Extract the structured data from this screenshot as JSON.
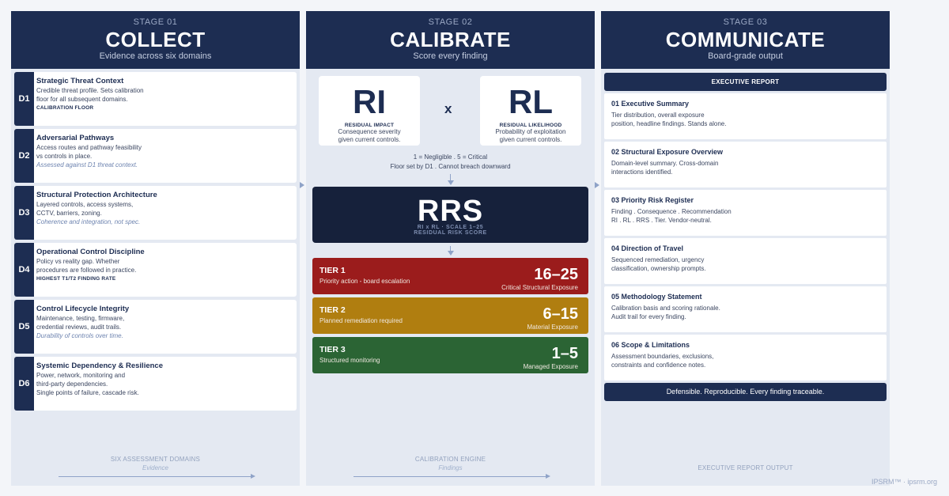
{
  "stages": [
    {
      "stage": "STAGE 01",
      "title": "COLLECT",
      "subtitle": "Evidence across six domains",
      "footer": "SIX ASSESSMENT DOMAINS",
      "footer_sub": "Evidence"
    },
    {
      "stage": "STAGE 02",
      "title": "CALIBRATE",
      "subtitle": "Score every finding",
      "footer": "CALIBRATION ENGINE",
      "footer_sub": "Findings"
    },
    {
      "stage": "STAGE 03",
      "title": "COMMUNICATE",
      "subtitle": "Board-grade output",
      "footer": "EXECUTIVE REPORT OUTPUT",
      "footer_sub": ""
    }
  ],
  "domains": [
    {
      "code": "D1",
      "title": "Strategic Threat Context",
      "desc": "Credible threat profile. Sets calibration\nfloor for all subsequent domains.",
      "note": "",
      "key": "CALIBRATION FLOOR"
    },
    {
      "code": "D2",
      "title": "Adversarial Pathways",
      "desc": "Access routes and pathway feasibility\nvs controls in place.",
      "note": "Assessed against D1 threat context.",
      "key": ""
    },
    {
      "code": "D3",
      "title": "Structural Protection Architecture",
      "desc": "Layered controls, access systems,\nCCTV, barriers, zoning.",
      "note": "Coherence and integration, not spec.",
      "key": ""
    },
    {
      "code": "D4",
      "title": "Operational Control Discipline",
      "desc": "Policy vs reality gap. Whether\nprocedures are followed in practice.",
      "note": "",
      "key": "HIGHEST T1/T2 FINDING RATE"
    },
    {
      "code": "D5",
      "title": "Control Lifecycle Integrity",
      "desc": "Maintenance, testing, firmware,\ncredential reviews, audit trails.",
      "note": "Durability of controls over time.",
      "key": ""
    },
    {
      "code": "D6",
      "title": "Systemic Dependency & Resilience",
      "desc": "Power, network, monitoring and\nthird-party dependencies.\nSingle points of failure, cascade risk.",
      "note": "",
      "key": ""
    }
  ],
  "calibrate": {
    "ri": {
      "abbr": "RI",
      "label": "RESIDUAL IMPACT",
      "desc": "Consequence severity\ngiven current controls."
    },
    "rl": {
      "abbr": "RL",
      "label": "RESIDUAL LIKELIHOOD",
      "desc": "Probability of exploitation\ngiven current controls."
    },
    "times": "x",
    "scale_line1": "1 = Negligible  .  5 = Critical",
    "scale_line2": "Floor set by D1 .  Cannot breach downward",
    "rrs": {
      "abbr": "RRS",
      "formula": "RI x RL  ·  SCALE 1–25",
      "label": "RESIDUAL RISK SCORE"
    },
    "tiers": [
      {
        "name": "TIER 1",
        "desc": "Priority action - board escalation",
        "range": "16–25",
        "category": "Critical Structural Exposure",
        "color": "#9b1c1c"
      },
      {
        "name": "TIER 2",
        "desc": "Planned remediation required",
        "range": "6–15",
        "category": "Material Exposure",
        "color": "#b07e10"
      },
      {
        "name": "TIER 3",
        "desc": "Structured monitoring",
        "range": "1–5",
        "category": "Managed Exposure",
        "color": "#2b6434"
      }
    ]
  },
  "report": {
    "header": "EXECUTIVE REPORT",
    "sections": [
      {
        "title": "01  Executive Summary",
        "desc": "Tier distribution, overall exposure\nposition, headline findings. Stands alone."
      },
      {
        "title": "02  Structural Exposure Overview",
        "desc": "Domain-level summary. Cross-domain\ninteractions identified."
      },
      {
        "title": "03  Priority Risk Register",
        "desc": "Finding . Consequence . Recommendation\nRI . RL . RRS . Tier. Vendor-neutral."
      },
      {
        "title": "04  Direction of Travel",
        "desc": "Sequenced remediation, urgency\nclassification, ownership prompts."
      },
      {
        "title": "05  Methodology Statement",
        "desc": "Calibration basis and scoring rationale.\nAudit trail for every finding."
      },
      {
        "title": "06  Scope & Limitations",
        "desc": "Assessment boundaries, exclusions,\nconstraints and confidence notes."
      }
    ],
    "closing": "Defensible. Reproducible. Every finding traceable."
  },
  "brand": "IPSRM™ · ipsrm.org",
  "colors": {
    "navy": "#1d2d52",
    "dark_navy": "#16213b",
    "panel": "#e4e9f2",
    "tier1": "#9b1c1c",
    "tier2": "#b07e10",
    "tier3": "#2b6434"
  }
}
